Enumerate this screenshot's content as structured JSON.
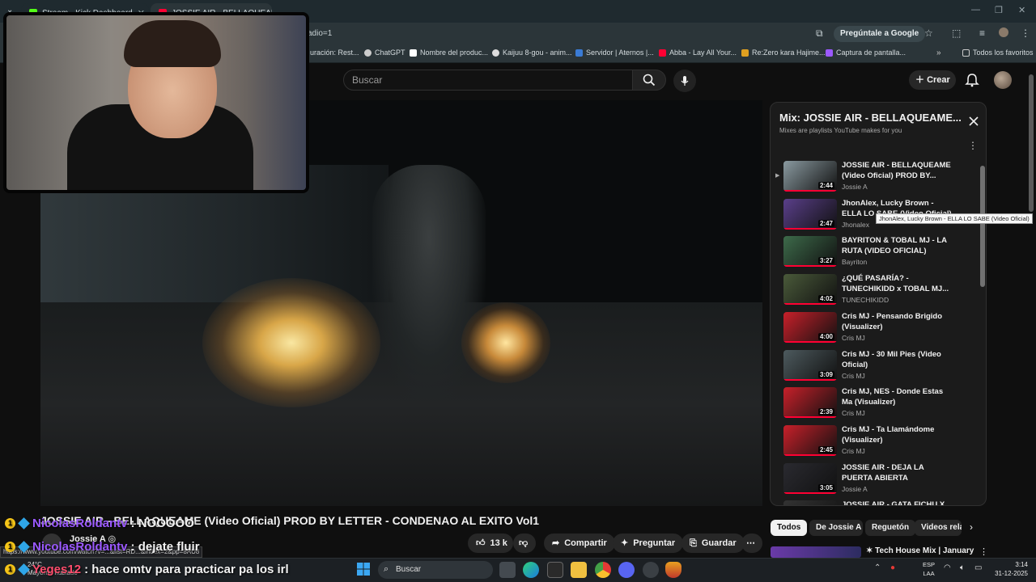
{
  "browser": {
    "tabs": [
      {
        "label": "Stream - Kick Dashboard",
        "favicon_color": "#53fc18"
      },
      {
        "label": "JOSSIE AIR - BELLAQUEAM",
        "favicon_color": "#ff0033"
      }
    ],
    "url": "adio=1",
    "ask_google": "Pregúntale a Google",
    "bookmarks": [
      {
        "label": "uración: Rest...",
        "color": "#888888"
      },
      {
        "label": "ChatGPT",
        "color": "#cccccc"
      },
      {
        "label": "Nombre del produc...",
        "color": "#ffffff"
      },
      {
        "label": "Kaijuu 8-gou - anim...",
        "color": "#dddddd"
      },
      {
        "label": "Servidor | Aternos |...",
        "color": "#3a7bd5"
      },
      {
        "label": "Abba - Lay All Your...",
        "color": "#ff0033"
      },
      {
        "label": "Re:Zero kara Hajime...",
        "color": "#e0a020"
      },
      {
        "label": "Captura de pantalla...",
        "color": "#9b59ff"
      }
    ],
    "all_favorites": "Todos los favoritos"
  },
  "youtube": {
    "search_placeholder": "Buscar",
    "create_label": "Crear",
    "video_title": "JOSSIE AIR - BELLAQUEAME (Video Oficial) PROD BY LETTER - CONDENAO AL EXITO Vol1",
    "channel": "Jossie A",
    "likes": "13 k",
    "share": "Compartir",
    "ask": "Preguntar",
    "save": "Guardar",
    "chips": [
      "Todos",
      "De Jossie A",
      "Reguetón",
      "Videos rela"
    ],
    "next_video": "Tech House Mix | January"
  },
  "playlist": {
    "title": "Mix: JOSSIE AIR - BELLAQUEAME...",
    "subtitle": "Mixes are playlists YouTube makes for you",
    "items": [
      {
        "title": "JOSSIE AIR - BELLAQUEAME (Video Oficial) PROD BY...",
        "channel": "Jossie A",
        "duration": "2:44",
        "thumb": "#8a9aa0"
      },
      {
        "title": "JhonAlex, Lucky Brown - ELLA LO SABE (Video Oficial)",
        "channel": "Jhonalex",
        "duration": "2:47",
        "thumb": "#5a3f8a"
      },
      {
        "title": "BAYRITON & TOBAL MJ - LA RUTA (VIDEO OFICIAL)",
        "channel": "Bayriton",
        "duration": "3:27",
        "thumb": "#3d6a4a"
      },
      {
        "title": "¿QUÉ PASARÍA? - TUNECHIKIDD x TOBAL MJ...",
        "channel": "TUNECHIKIDD",
        "duration": "4:02",
        "thumb": "#4a5a3a"
      },
      {
        "title": "Cris MJ - Pensando Brigido (Visualizer)",
        "channel": "Cris MJ",
        "duration": "4:00",
        "thumb": "#c8202a"
      },
      {
        "title": "Cris MJ - 30 Mil Pies (Video Oficial)",
        "channel": "Cris MJ",
        "duration": "3:09",
        "thumb": "#4d5a5e"
      },
      {
        "title": "Cris MJ, NES - Donde Estas Ma (Visualizer)",
        "channel": "Cris MJ",
        "duration": "2:39",
        "thumb": "#c8202a"
      },
      {
        "title": "Cris MJ - Ta Llamándome (Visualizer)",
        "channel": "Cris MJ",
        "duration": "2:45",
        "thumb": "#c8202a"
      },
      {
        "title": "JOSSIE AIR - DEJA LA PUERTA ABIERTA (Visualizer)...",
        "channel": "Jossie A",
        "duration": "3:05",
        "thumb": "#2a2a30"
      },
      {
        "title": "JOSSIE AIR - GATA FICHU X",
        "channel": "",
        "duration": "",
        "thumb": "#333333"
      }
    ],
    "tooltip": "JhonAlex, Lucky Brown - ELLA LO SABE (Video Oficial)"
  },
  "chat": [
    {
      "user": "NicolasRoldantv",
      "msg": ": NOOOOO"
    },
    {
      "user": "NicolasRoldantv",
      "msg": ": dejate fluir"
    },
    {
      "user": "Yeges12",
      "msg": ": hace omtv para practicar pa los irl"
    }
  ],
  "status_url": "https://www.youtube.com/watch?v=...&list=RD...&index=2&pp=8AU8",
  "taskbar": {
    "weather_temp": "24°C",
    "weather_desc": "Mayorm. nublado",
    "search": "Buscar",
    "lang_1": "ESP",
    "lang_2": "LAA",
    "time": "3:14",
    "date": "31-12-2025"
  }
}
